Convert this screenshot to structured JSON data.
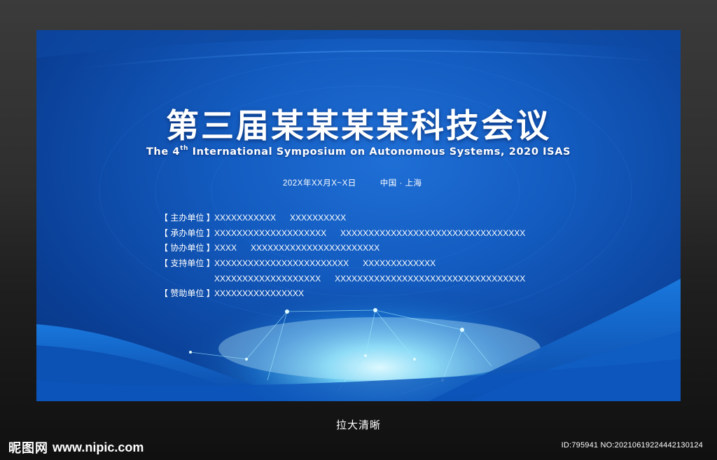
{
  "banner": {
    "title": "第三届某某某某科技会议",
    "subtitle_pre": "The 4",
    "subtitle_sup": "th",
    "subtitle_post": " International Symposium on Autonomous Systems, 2020 ISAS",
    "date": "202X年XX月X~X日",
    "location": "中国 · 上海",
    "organizers": [
      {
        "label": "【 主办单位 】",
        "value1": "XXXXXXXXXXX",
        "value2": "XXXXXXXXXX"
      },
      {
        "label": "【 承办单位 】",
        "value1": "XXXXXXXXXXXXXXXXXXXX",
        "value2": "XXXXXXXXXXXXXXXXXXXXXXXXXXXXXXXXX"
      },
      {
        "label": "【 协办单位 】",
        "value1": "XXXX",
        "value2": "XXXXXXXXXXXXXXXXXXXXXXX"
      },
      {
        "label": "【 支持单位 】",
        "value1": "XXXXXXXXXXXXXXXXXXXXXXXX",
        "value2": "XXXXXXXXXXXXX"
      },
      {
        "label": "",
        "value1": "XXXXXXXXXXXXXXXXXXX",
        "value2": "XXXXXXXXXXXXXXXXXXXXXXXXXXXXXXXXXX"
      },
      {
        "label": "【 赞助单位 】",
        "value1": "XXXXXXXXXXXXXXXX",
        "value2": ""
      }
    ]
  },
  "caption": "拉大清晰",
  "watermark": {
    "site_name": "昵图网",
    "url": "www.nipic.com",
    "id_text": "ID:795941 NO:20210619224442130124"
  },
  "colors": {
    "banner_blue": "#135bbf",
    "deep_blue": "#08337c",
    "glow": "#7fe3ff"
  }
}
